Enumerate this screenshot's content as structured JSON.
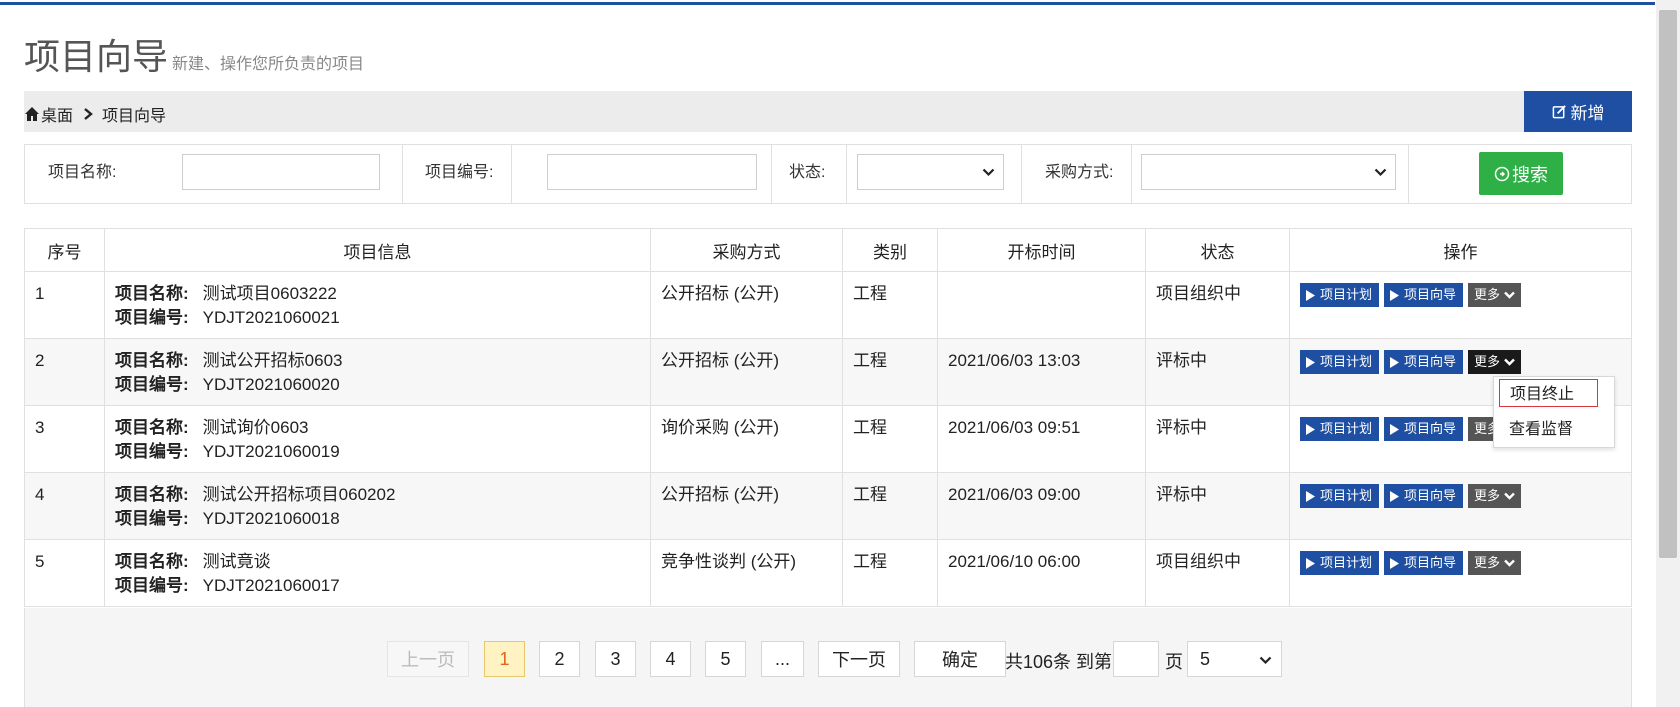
{
  "header": {
    "title": "项目向导",
    "subtitle": "新建、操作您所负责的项目"
  },
  "breadcrumb": {
    "home": "桌面",
    "current": "项目向导"
  },
  "add_button": "新增",
  "filters": {
    "name_label": "项目名称:",
    "code_label": "项目编号:",
    "status_label": "状态:",
    "method_label": "采购方式:",
    "name_value": "",
    "code_value": "",
    "status_value": "",
    "method_value": "",
    "search_label": "搜索"
  },
  "table": {
    "headers": [
      "序号",
      "项目信息",
      "采购方式",
      "类别",
      "开标时间",
      "状态",
      "操作"
    ],
    "name_label": "项目名称:",
    "code_label": "项目编号:",
    "rows": [
      {
        "no": "1",
        "name": "测试项目0603222",
        "code": "YDJT2021060021",
        "method": "公开招标 (公开)",
        "category": "工程",
        "time": "",
        "status": "项目组织中"
      },
      {
        "no": "2",
        "name": "测试公开招标0603",
        "code": "YDJT2021060020",
        "method": "公开招标 (公开)",
        "category": "工程",
        "time": "2021/06/03 13:03",
        "status": "评标中"
      },
      {
        "no": "3",
        "name": "测试询价0603",
        "code": "YDJT2021060019",
        "method": "询价采购 (公开)",
        "category": "工程",
        "time": "2021/06/03 09:51",
        "status": "评标中"
      },
      {
        "no": "4",
        "name": "测试公开招标项目060202",
        "code": "YDJT2021060018",
        "method": "公开招标 (公开)",
        "category": "工程",
        "time": "2021/06/03 09:00",
        "status": "评标中"
      },
      {
        "no": "5",
        "name": "测试竟谈",
        "code": "YDJT2021060017",
        "method": "竞争性谈判 (公开)",
        "category": "工程",
        "time": "2021/06/10 06:00",
        "status": "项目组织中"
      }
    ],
    "ops": {
      "plan": "项目计划",
      "guide": "项目向导",
      "more": "更多"
    }
  },
  "dropdown": {
    "items": [
      "项目终止",
      "查看监督"
    ]
  },
  "pagination": {
    "prev": "上一页",
    "pages": [
      "1",
      "2",
      "3",
      "4",
      "5",
      "..."
    ],
    "current_page": "1",
    "next": "下一页",
    "confirm": "确定",
    "total_text": "共106条 到第",
    "page_input_value": "",
    "page_unit": "页",
    "page_size": "5"
  },
  "colors": {
    "primary": "#1f4fa3",
    "search": "#2eb046",
    "more": "#555555",
    "highlight_border": "#d9363e",
    "current_page_bg": "#fff3c4"
  },
  "icons": [
    "home-icon",
    "chevron-right-icon",
    "edit-icon",
    "search-icon",
    "play-icon",
    "chevron-down-icon"
  ]
}
